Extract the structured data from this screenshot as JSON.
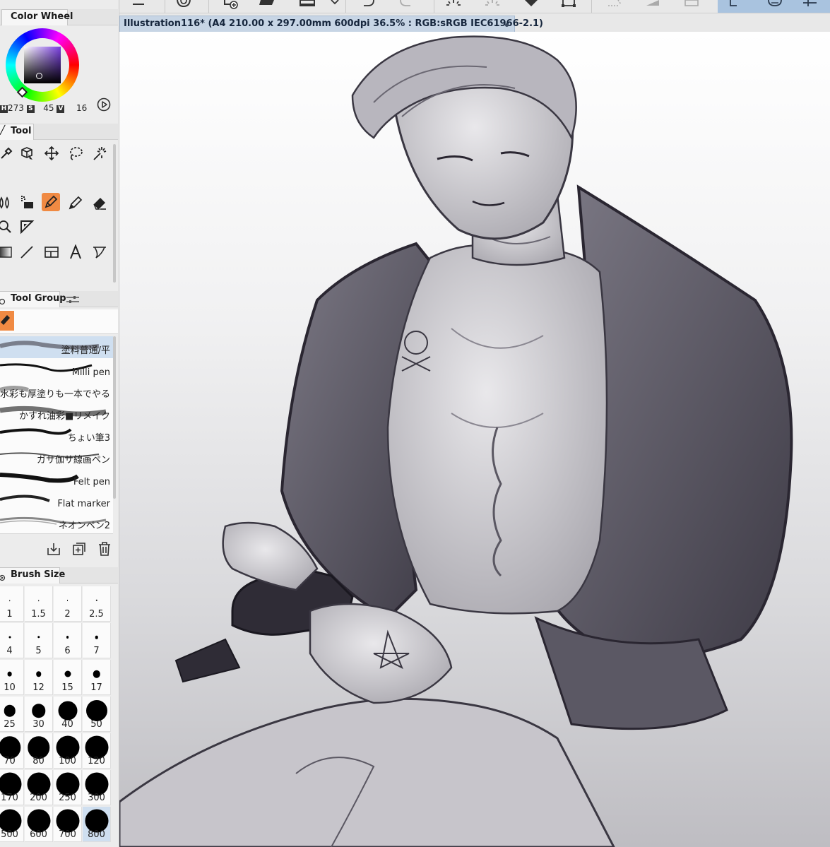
{
  "colors": {
    "accent_orange": "#f08a43",
    "selection_blue": "#cfdff0",
    "doc_tab_bg": "#c7d5e5",
    "panel_bg": "#ececec",
    "current_color": "#2a2631"
  },
  "color_wheel": {
    "title": "Color Wheel",
    "h_label": "H",
    "s_label": "S",
    "v_label": "V",
    "h_value": "273",
    "s_value": "45",
    "v_value": "16"
  },
  "tool_panel": {
    "title": "Tool",
    "icons": [
      "dropper-icon",
      "object-icon",
      "move-icon",
      "lasso-icon",
      "wand-icon",
      "blend-icon",
      "fill-icon",
      "pen-icon",
      "pencil-icon",
      "eraser-icon",
      "zoom-icon",
      "ruler-icon",
      "gradient-icon",
      "line-icon",
      "frame-icon",
      "text-icon",
      "balloon-icon"
    ],
    "active_icon": "pen-icon"
  },
  "tool_group": {
    "title": "Tool Group",
    "brushes": [
      {
        "label": "塗料普通/平",
        "selected": true
      },
      {
        "label": "Milli pen",
        "selected": false
      },
      {
        "label": "水彩も厚塗りも一本でやる",
        "selected": false
      },
      {
        "label": "かすれ油彩■リメイク",
        "selected": false
      },
      {
        "label": "ちょい筆3",
        "selected": false
      },
      {
        "label": "ガサ伽サ線画ペン",
        "selected": false
      },
      {
        "label": "Felt pen",
        "selected": false
      },
      {
        "label": "Flat marker",
        "selected": false
      },
      {
        "label": "ネオンペン2",
        "selected": false
      }
    ]
  },
  "brush_size": {
    "title": "Brush Size",
    "sizes": [
      "1",
      "1.5",
      "2",
      "2.5",
      "4",
      "5",
      "6",
      "7",
      "10",
      "12",
      "15",
      "17",
      "25",
      "30",
      "40",
      "50",
      "70",
      "80",
      "100",
      "120",
      "170",
      "200",
      "250",
      "300",
      "500",
      "600",
      "700",
      "800"
    ],
    "selected": "800"
  },
  "document": {
    "title": "Illustration116* (A4 210.00 x 297.00mm 600dpi 36.5% : RGB:sRGB IEC61966-2.1)"
  }
}
